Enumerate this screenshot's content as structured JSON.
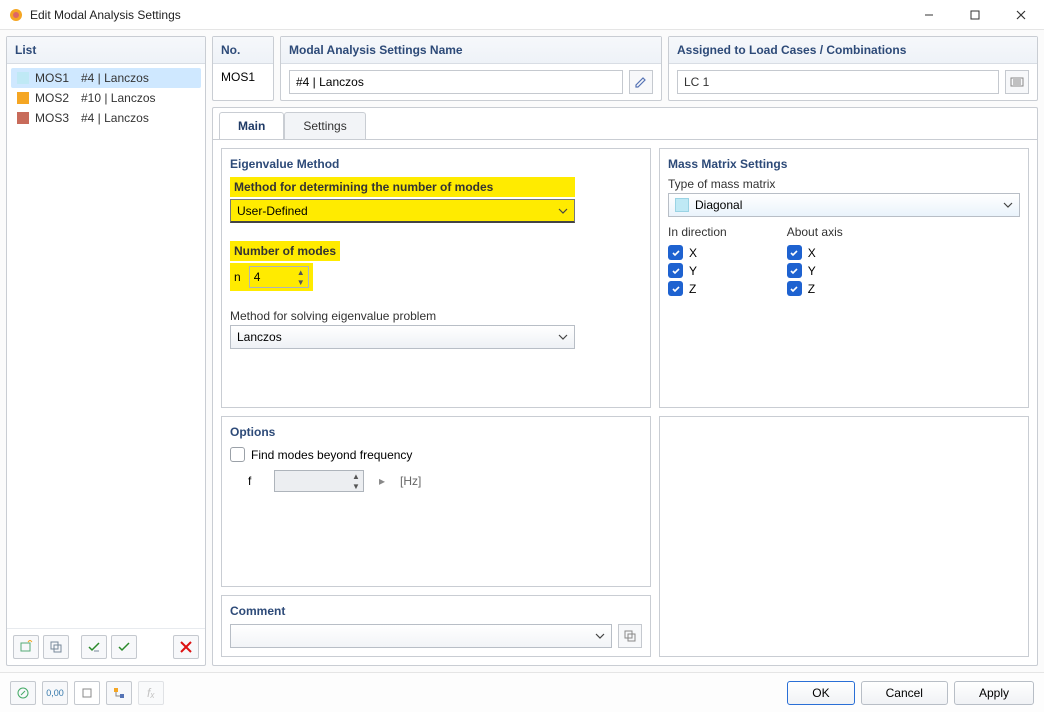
{
  "window": {
    "title": "Edit Modal Analysis Settings"
  },
  "sidebar": {
    "title": "List",
    "items": [
      {
        "id": "MOS1",
        "name": "#4 | Lanczos",
        "color": "#bfe9f5",
        "selected": true
      },
      {
        "id": "MOS2",
        "name": "#10 | Lanczos",
        "color": "#f5a623",
        "selected": false
      },
      {
        "id": "MOS3",
        "name": "#4 | Lanczos",
        "color": "#c86b5a",
        "selected": false
      }
    ]
  },
  "header": {
    "no_label": "No.",
    "no_value": "MOS1",
    "name_label": "Modal Analysis Settings Name",
    "name_value": "#4 | Lanczos",
    "assigned_label": "Assigned to Load Cases / Combinations",
    "assigned_value": "LC 1"
  },
  "tabs": {
    "main": "Main",
    "settings": "Settings",
    "active": "main"
  },
  "eigenvalue": {
    "title": "Eigenvalue Method",
    "method_label": "Method for determining the number of modes",
    "method_value": "User-Defined",
    "num_label": "Number of modes",
    "num_symbol": "n",
    "num_value": "4",
    "solver_label": "Method for solving eigenvalue problem",
    "solver_value": "Lanczos"
  },
  "mass": {
    "title": "Mass Matrix Settings",
    "type_label": "Type of mass matrix",
    "type_value": "Diagonal",
    "direction_label": "In direction",
    "axis_label": "About axis",
    "axes": [
      "X",
      "Y",
      "Z"
    ]
  },
  "options": {
    "title": "Options",
    "find_label": "Find modes beyond frequency",
    "f_symbol": "f",
    "f_unit": "[Hz]"
  },
  "comment": {
    "title": "Comment"
  },
  "footer": {
    "ok": "OK",
    "cancel": "Cancel",
    "apply": "Apply"
  }
}
